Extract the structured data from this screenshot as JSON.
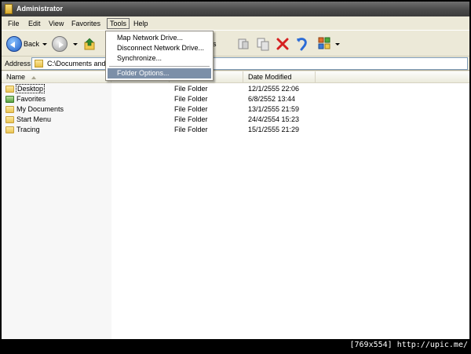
{
  "window": {
    "title": "Administrator"
  },
  "menubar": {
    "items": [
      {
        "label": "File"
      },
      {
        "label": "Edit"
      },
      {
        "label": "View"
      },
      {
        "label": "Favorites"
      },
      {
        "label": "Tools"
      },
      {
        "label": "Help"
      }
    ]
  },
  "toolbar": {
    "back_label": "Back",
    "folders_label": "lders",
    "icons": [
      "back-arrow-icon",
      "forward-arrow-icon",
      "up-folder-icon",
      "folders-icon",
      "move-to-icon",
      "copy-to-icon",
      "delete-icon",
      "undo-icon",
      "views-icon"
    ]
  },
  "address": {
    "label": "Address",
    "value": "C:\\Documents and S"
  },
  "tools_menu": {
    "items": [
      {
        "label": "Map Network Drive..."
      },
      {
        "label": "Disconnect Network Drive..."
      },
      {
        "label": "Synchronize..."
      },
      {
        "label": "Folder Options..."
      }
    ],
    "highlighted": "Folder Options..."
  },
  "list": {
    "columns": [
      {
        "label": "Name"
      },
      {
        "label": ""
      },
      {
        "label": ""
      },
      {
        "label": "Date Modified"
      }
    ],
    "rows": [
      {
        "name": "Desktop",
        "type": "File Folder",
        "date": "12/1/2555 22:06"
      },
      {
        "name": "Favorites",
        "type": "File Folder",
        "date": "6/8/2552 13:44"
      },
      {
        "name": "My Documents",
        "type": "File Folder",
        "date": "13/1/2555 21:59"
      },
      {
        "name": "Start Menu",
        "type": "File Folder",
        "date": "24/4/2554 15:23"
      },
      {
        "name": "Tracing",
        "type": "File Folder",
        "date": "15/1/2555 21:29"
      }
    ]
  },
  "watermark": "[769x554] http://upic.me/",
  "colors": {
    "menu_highlight": "#7c8fa8",
    "window_face": "#ece9d8",
    "titlebar": "#4a4a4a",
    "delete_icon": "#d62020"
  }
}
